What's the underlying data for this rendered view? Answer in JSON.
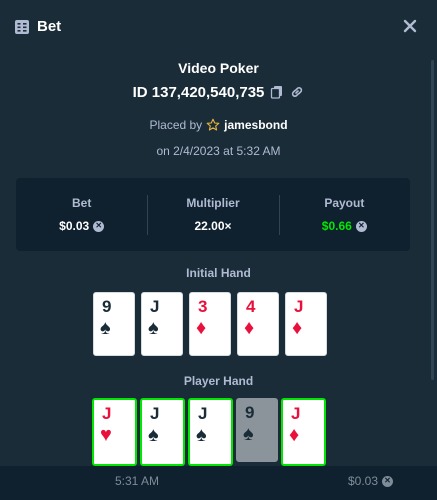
{
  "header": {
    "title": "Bet"
  },
  "game": {
    "name": "Video Poker",
    "bet_id": "ID 137,420,540,735",
    "placed_by_prefix": "Placed by",
    "username": "jamesbond",
    "date": "on 2/4/2023 at 5:32 AM"
  },
  "stats": {
    "bet_label": "Bet",
    "bet_value": "$0.03",
    "multiplier_label": "Multiplier",
    "multiplier_value": "22.00×",
    "payout_label": "Payout",
    "payout_value": "$0.66"
  },
  "initial_hand": {
    "label": "Initial Hand",
    "cards": [
      {
        "rank": "9",
        "suit": "♠",
        "color": "black"
      },
      {
        "rank": "J",
        "suit": "♠",
        "color": "black"
      },
      {
        "rank": "3",
        "suit": "♦",
        "color": "red"
      },
      {
        "rank": "4",
        "suit": "♦",
        "color": "red"
      },
      {
        "rank": "J",
        "suit": "♦",
        "color": "red"
      }
    ]
  },
  "player_hand": {
    "label": "Player Hand",
    "cards": [
      {
        "rank": "J",
        "suit": "♥",
        "color": "red",
        "held": true
      },
      {
        "rank": "J",
        "suit": "♠",
        "color": "black",
        "held": true
      },
      {
        "rank": "J",
        "suit": "♠",
        "color": "black",
        "held": true
      },
      {
        "rank": "9",
        "suit": "♠",
        "color": "black",
        "held": false
      },
      {
        "rank": "J",
        "suit": "♦",
        "color": "red",
        "held": true
      }
    ]
  },
  "footer": {
    "time": "5:31 AM",
    "amount": "$0.03"
  },
  "colors": {
    "background": "#1a2c38",
    "panel": "#0f212e",
    "accent_green": "#00e701",
    "muted": "#b1bad3",
    "red_suit": "#e9113c"
  },
  "icons": [
    "bet-list-icon",
    "close-icon",
    "copy-icon",
    "link-icon",
    "star-icon",
    "currency-icon"
  ]
}
